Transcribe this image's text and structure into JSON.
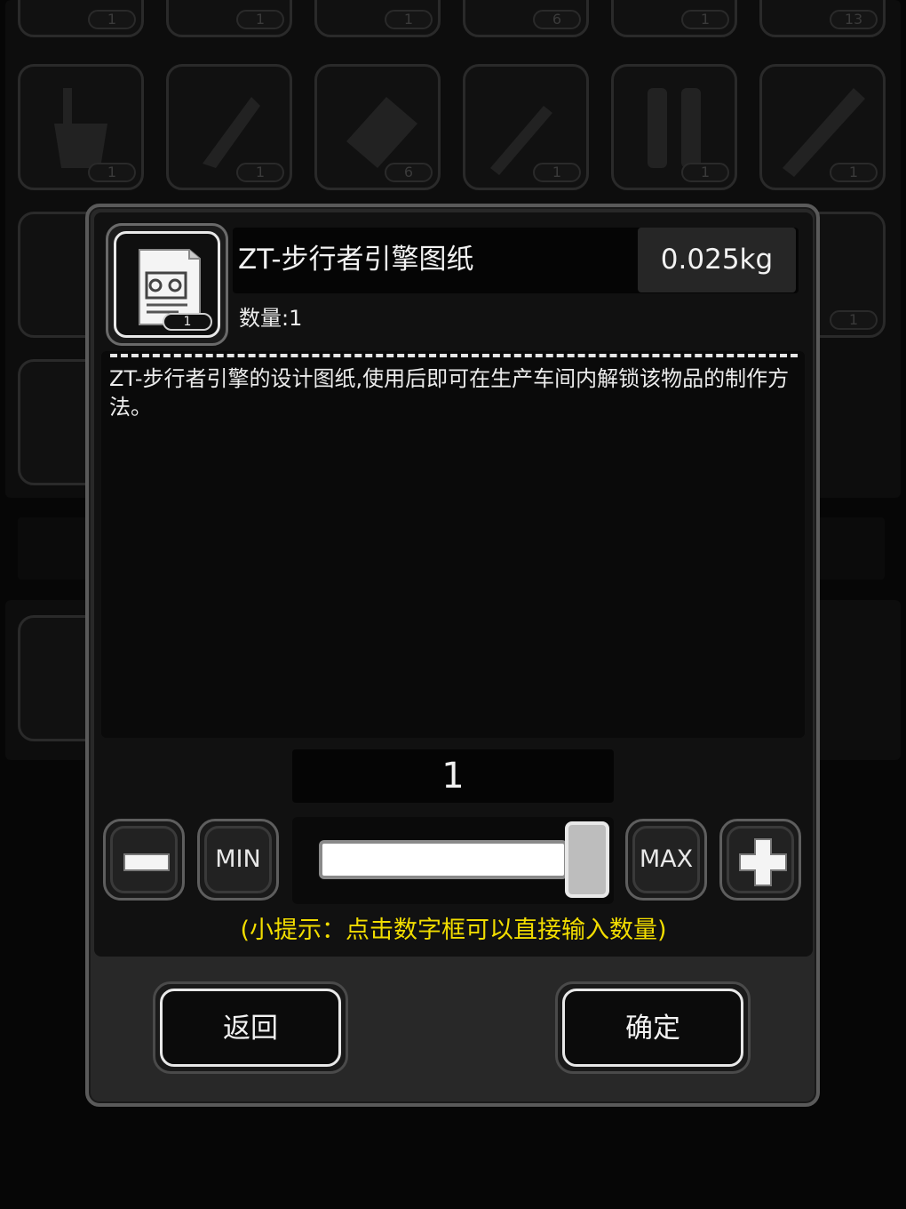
{
  "background": {
    "slot_counts": [
      "1",
      "1",
      "1",
      "6",
      "1",
      "13",
      "1",
      "1",
      "6",
      "1",
      "1",
      "1",
      "1"
    ]
  },
  "item": {
    "name": "ZT-步行者引擎图纸",
    "weight": "0.025kg",
    "quantity_label": "数量:1",
    "icon_count": "1",
    "icon": "blueprint-icon",
    "description": "ZT-步行者引擎的设计图纸,使用后即可在生产车间内解锁该物品的制作方法。"
  },
  "quantity": {
    "value": "1",
    "min_label": "MIN",
    "max_label": "MAX",
    "slider_level": 1.0
  },
  "hint": "(小提示：点击数字框可以直接输入数量)",
  "buttons": {
    "back": "返回",
    "confirm": "确定"
  },
  "colors": {
    "hint": "#f2dd00",
    "dialog_border": "#5a5a5a",
    "text": "#f2f2f2"
  }
}
